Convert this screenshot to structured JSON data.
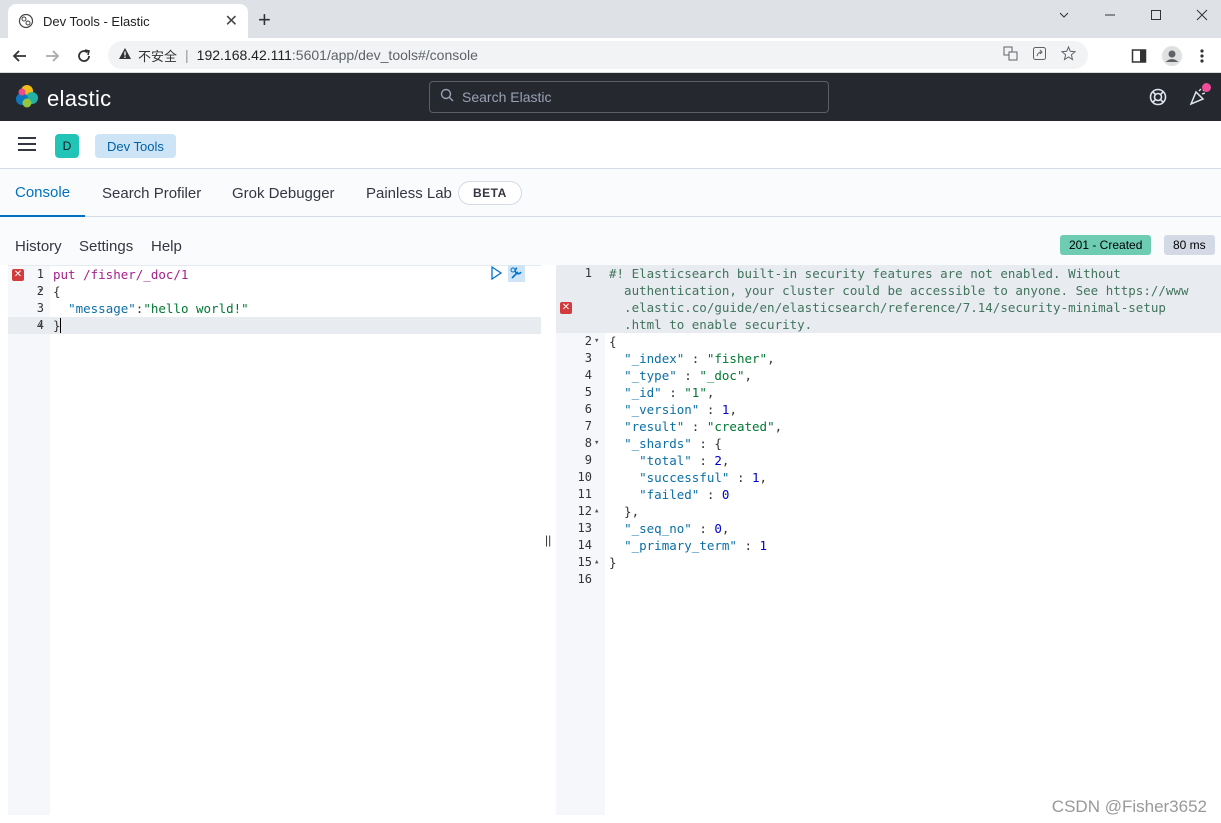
{
  "browser": {
    "tab_title": "Dev Tools - Elastic",
    "tab_close": "✕",
    "new_tab": "+",
    "insecure_label": "不安全",
    "url_host": "192.168.42.111",
    "url_path": ":5601/app/dev_tools#/console"
  },
  "header": {
    "brand": "elastic",
    "search_placeholder": "Search Elastic"
  },
  "breadcrumb": {
    "space_initial": "D",
    "current": "Dev Tools"
  },
  "tabs": [
    {
      "label": "Console"
    },
    {
      "label": "Search Profiler"
    },
    {
      "label": "Grok Debugger"
    },
    {
      "label": "Painless Lab"
    }
  ],
  "beta_badge": "BETA",
  "menu": {
    "history": "History",
    "settings": "Settings",
    "help": "Help"
  },
  "status": {
    "code": "201 - Created",
    "time": "80 ms"
  },
  "request": {
    "lines": [
      {
        "n": "1",
        "text": "put /fisher/_doc/1"
      },
      {
        "n": "2",
        "text": "{"
      },
      {
        "n": "3",
        "key": "\"message\"",
        "val": "\"hello world!\""
      },
      {
        "n": "4",
        "text": "}"
      }
    ]
  },
  "response": {
    "warning": [
      "#! Elasticsearch built-in security features are not enabled. Without",
      "  authentication, your cluster could be accessible to anyone. See https://www",
      "  .elastic.co/guide/en/elasticsearch/reference/7.14/security-minimal-setup",
      "  .html to enable security."
    ],
    "lines": [
      {
        "n": "2",
        "text": "{"
      },
      {
        "n": "3",
        "key": "\"_index\"",
        "val": "\"fisher\"",
        "type": "s",
        "indent": 1
      },
      {
        "n": "4",
        "key": "\"_type\"",
        "val": "\"_doc\"",
        "type": "s",
        "indent": 1
      },
      {
        "n": "5",
        "key": "\"_id\"",
        "val": "\"1\"",
        "type": "s",
        "indent": 1
      },
      {
        "n": "6",
        "key": "\"_version\"",
        "val": "1",
        "type": "n",
        "indent": 1
      },
      {
        "n": "7",
        "key": "\"result\"",
        "val": "\"created\"",
        "type": "s",
        "indent": 1
      },
      {
        "n": "8",
        "key": "\"_shards\"",
        "val": "{",
        "type": "p",
        "indent": 1,
        "noComma": true
      },
      {
        "n": "9",
        "key": "\"total\"",
        "val": "2",
        "type": "n",
        "indent": 2
      },
      {
        "n": "10",
        "key": "\"successful\"",
        "val": "1",
        "type": "n",
        "indent": 2
      },
      {
        "n": "11",
        "key": "\"failed\"",
        "val": "0",
        "type": "n",
        "indent": 2,
        "noComma": true
      },
      {
        "n": "12",
        "text": "  },"
      },
      {
        "n": "13",
        "key": "\"_seq_no\"",
        "val": "0",
        "type": "n",
        "indent": 1
      },
      {
        "n": "14",
        "key": "\"_primary_term\"",
        "val": "1",
        "type": "n",
        "indent": 1,
        "noComma": true
      },
      {
        "n": "15",
        "text": "}"
      },
      {
        "n": "16",
        "text": ""
      }
    ]
  },
  "watermark": "CSDN @Fisher3652"
}
